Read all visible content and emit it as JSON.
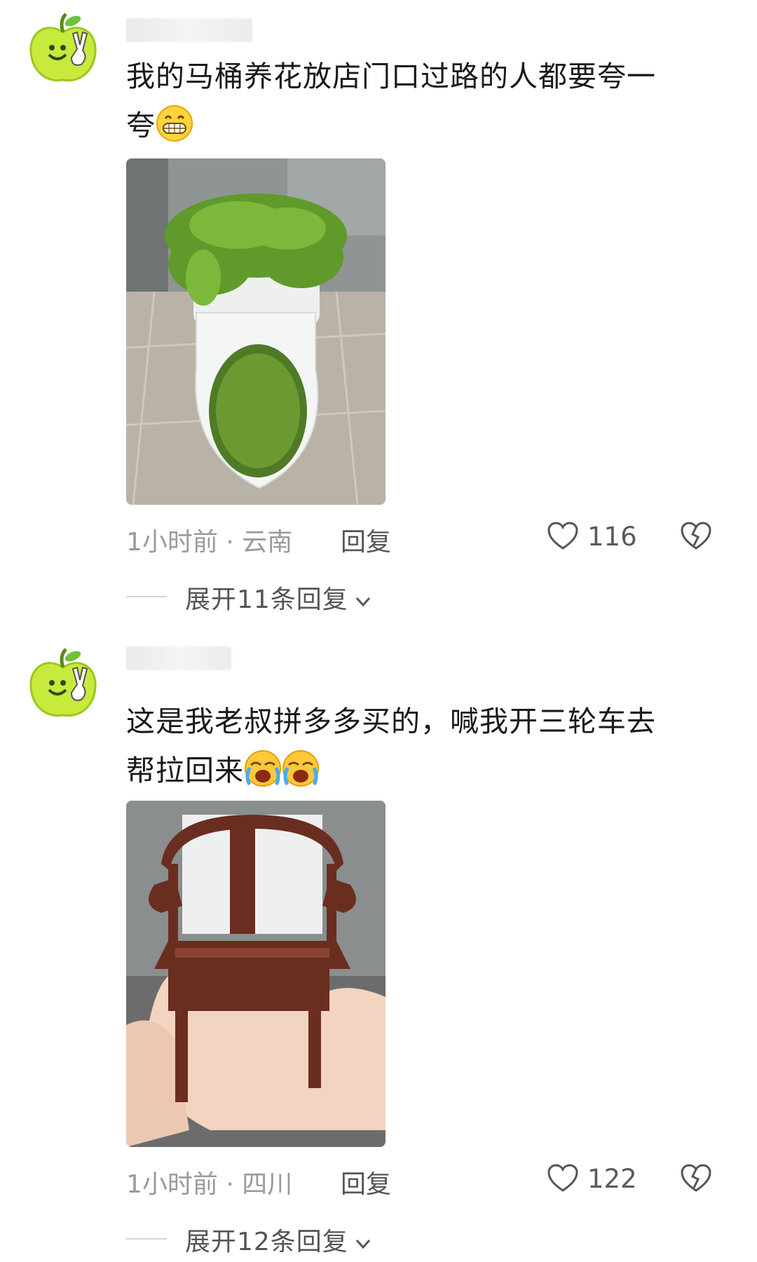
{
  "comments": [
    {
      "text_line1": "我的马桶养花放店门口过路的人都要夸一",
      "text_line2": "夸",
      "emoji": "grinning-face",
      "photo": "toilet-planter-photo",
      "time": "1小时前 · 云南",
      "reply_label": "回复",
      "likes": "116",
      "expand_label": "展开11条回复"
    },
    {
      "text_line1": "这是我老叔拼多多买的，喊我开三轮车去",
      "text_line2": "帮拉回来",
      "emoji": "loudly-crying-face",
      "photo": "miniature-chair-photo",
      "time": "1小时前 · 四川",
      "reply_label": "回复",
      "likes": "122",
      "expand_label": "展开12条回复"
    }
  ],
  "icons": {
    "avatar": "green-apple-avatar",
    "like": "heart-outline-icon",
    "dislike": "broken-heart-icon",
    "expand": "chevron-down-icon"
  },
  "colors": {
    "background": "#ffffff",
    "meta_text": "#9a9a9a",
    "avatar_green": "#b6e23a"
  }
}
